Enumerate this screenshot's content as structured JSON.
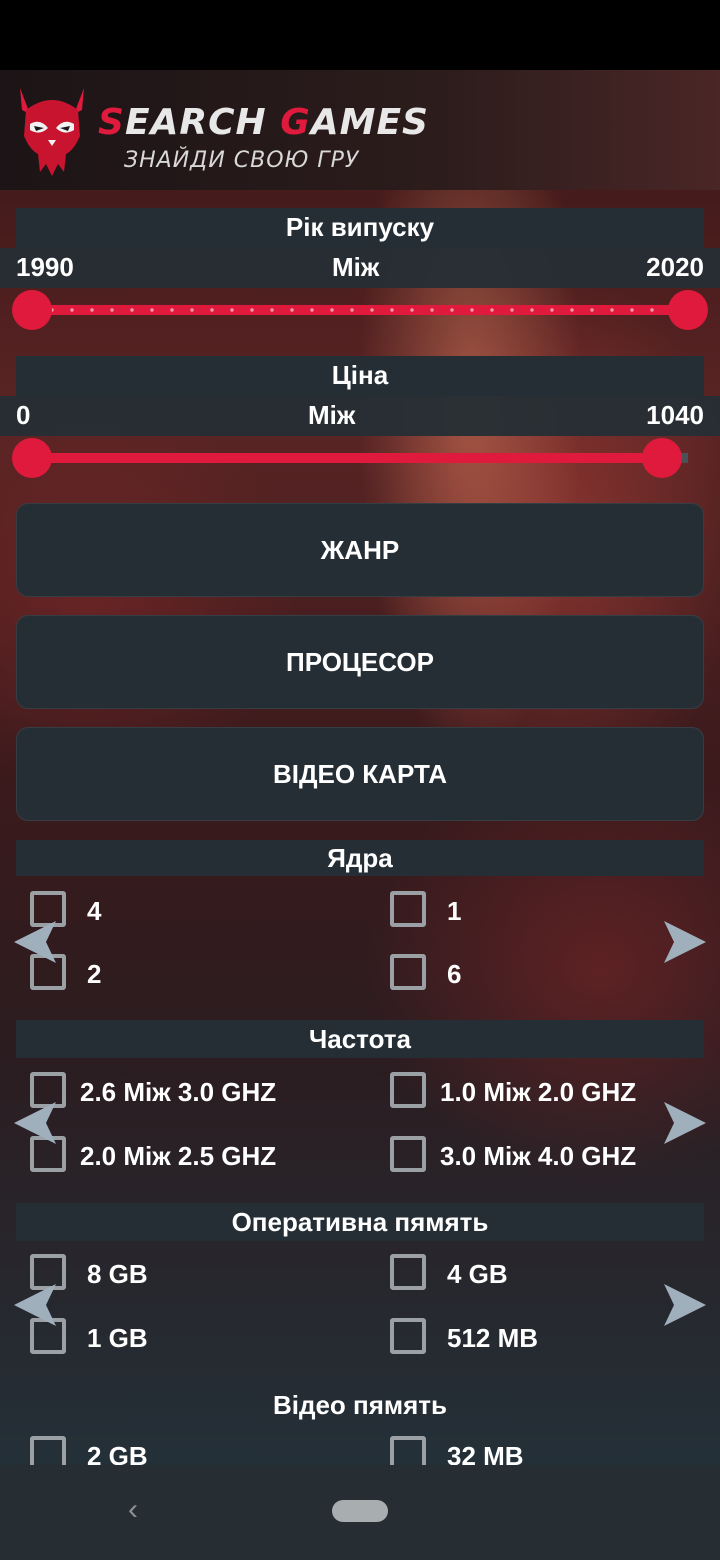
{
  "app": {
    "logo_title_first": "S",
    "logo_title_mid": "EARCH ",
    "logo_title_g": "G",
    "logo_title_end": "AMES",
    "logo_subtitle": "ЗНАЙДИ СВОЮ ГРУ"
  },
  "colors": {
    "accent": "#e01a3c",
    "panel": "#252e35",
    "checkbox_border": "#9aa0a4"
  },
  "year_filter": {
    "title": "Рік випуску",
    "min_label": "1990",
    "between_label": "Між",
    "max_label": "2020",
    "range": [
      1990,
      2020
    ]
  },
  "price_filter": {
    "title": "Ціна",
    "min_label": "0",
    "between_label": "Між",
    "max_label": "1040",
    "range": [
      0,
      1040
    ]
  },
  "buttons": {
    "genre": "ЖАНР",
    "processor": "ПРОЦЕСОР",
    "video_card": "ВІДЕО КАРТА"
  },
  "cores": {
    "title": "Ядра",
    "options": [
      "4",
      "1",
      "2",
      "6"
    ]
  },
  "frequency": {
    "title": "Частота",
    "options": [
      "2.6 Між 3.0 GHZ",
      "1.0 Між 2.0 GHZ",
      "2.0 Між 2.5 GHZ",
      "3.0 Між 4.0 GHZ"
    ]
  },
  "ram": {
    "title": "Оперативна пямять",
    "options": [
      "8 GB",
      "4 GB",
      "1 GB",
      "512 MB"
    ]
  },
  "vram": {
    "title": "Відео пямять",
    "options": [
      "2 GB",
      "32 MB"
    ]
  },
  "icons": {
    "prev": "chevron-left-icon",
    "next": "chevron-right-icon",
    "nav_back": "back-icon",
    "nav_home": "home-pill-icon"
  }
}
